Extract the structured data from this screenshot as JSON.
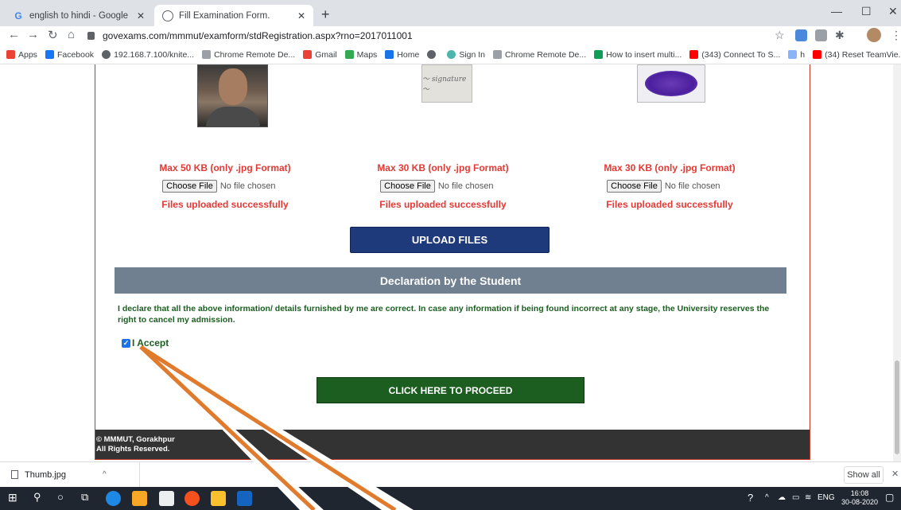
{
  "browser": {
    "tabs": [
      {
        "title": "english to hindi - Google Search",
        "icon": "google-icon"
      },
      {
        "title": "Fill Examination Form.",
        "icon": "globe-icon"
      }
    ],
    "url": "govexams.com/mmmut/examform/stdRegistration.aspx?rno=2017011001",
    "bookmarks": [
      {
        "label": "Apps",
        "color": "#ea4335"
      },
      {
        "label": "Facebook",
        "color": "#1877f2"
      },
      {
        "label": "192.168.7.100/knite...",
        "color": "#5f6368"
      },
      {
        "label": "Chrome Remote De...",
        "color": "#9aa0a6"
      },
      {
        "label": "Gmail",
        "color": "#ea4335"
      },
      {
        "label": "Maps",
        "color": "#34a853"
      },
      {
        "label": "Home",
        "color": "#1a73e8"
      },
      {
        "label": "",
        "color": "#5f6368"
      },
      {
        "label": "Sign In",
        "color": "#4db6ac"
      },
      {
        "label": "Chrome Remote De...",
        "color": "#9aa0a6"
      },
      {
        "label": "How to insert multi...",
        "color": "#0f9d58"
      },
      {
        "label": "(343) Connect To S...",
        "color": "#ff0000"
      },
      {
        "label": "h",
        "color": "#8ab4f8"
      },
      {
        "label": "(34) Reset TeamVie...",
        "color": "#ff0000"
      }
    ]
  },
  "form": {
    "uploads": [
      {
        "max": "Max 50 KB (only .jpg Format)",
        "button": "Choose File",
        "status": "No file chosen",
        "result": "Files uploaded successfully"
      },
      {
        "max": "Max 30 KB (only .jpg Format)",
        "button": "Choose File",
        "status": "No file chosen",
        "result": "Files uploaded successfully"
      },
      {
        "max": "Max 30 KB (only .jpg Format)",
        "button": "Choose File",
        "status": "No file chosen",
        "result": "Files uploaded successfully"
      }
    ],
    "upload_button": "UPLOAD FILES",
    "declaration_heading": "Declaration by the Student",
    "declaration_text": "I declare that all the above information/ details furnished by me are correct. In case any information if being found incorrect at any stage, the University reserves the right to cancel my admission.",
    "accept_label": "I Accept",
    "accept_checked": true,
    "proceed_button": "CLICK HERE TO PROCEED",
    "footer_line1": "© MMMUT, Gorakhpur",
    "footer_line2": "All Rights Reserved."
  },
  "downloads": {
    "file": "Thumb.jpg",
    "show_all": "Show all"
  },
  "taskbar": {
    "lang": "ENG",
    "time": "16:08",
    "date": "30-08-2020"
  },
  "colors": {
    "accent_red": "#e53935",
    "upload_blue": "#1f3a7a",
    "proceed_green": "#1b5e20",
    "annotation_arrow": "#e07b2e"
  }
}
